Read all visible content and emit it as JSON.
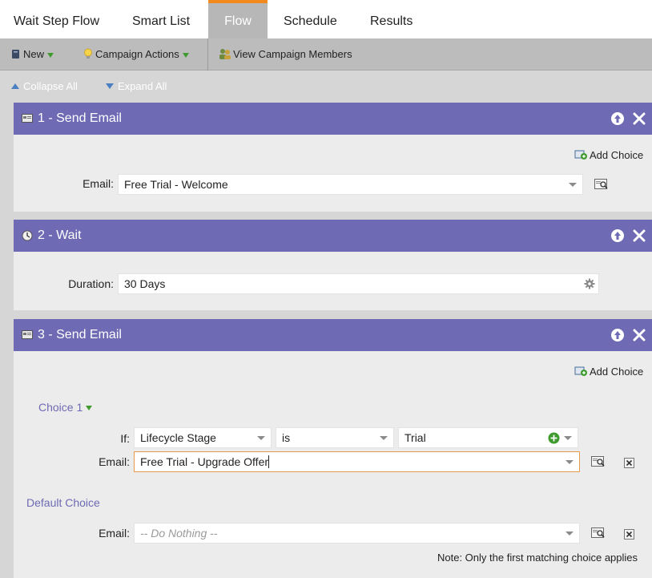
{
  "tabs": [
    {
      "label": "Wait Step Flow"
    },
    {
      "label": "Smart List"
    },
    {
      "label": "Flow",
      "active": true
    },
    {
      "label": "Schedule"
    },
    {
      "label": "Results"
    }
  ],
  "toolbar": {
    "new_label": "New",
    "campaign_actions_label": "Campaign Actions",
    "view_members_label": "View Campaign Members"
  },
  "controls": {
    "collapse_all": "Collapse All",
    "expand_all": "Expand All"
  },
  "steps": [
    {
      "title": "1 - Send Email",
      "add_choice": "Add Choice",
      "email_label": "Email:",
      "email_value": "Free Trial - Welcome"
    },
    {
      "title": "2 - Wait",
      "duration_label": "Duration:",
      "duration_value": "30 Days"
    },
    {
      "title": "3 - Send Email",
      "add_choice": "Add Choice",
      "choice_label": "Choice 1",
      "if_label": "If:",
      "condition_field": "Lifecycle Stage",
      "condition_operator": "is",
      "condition_value": "Trial",
      "email_label": "Email:",
      "choice_email_value": "Free Trial - Upgrade Offer",
      "default_choice_label": "Default Choice",
      "default_email_label": "Email:",
      "default_email_placeholder": "-- Do Nothing --",
      "note": "Note: Only the first matching choice applies"
    }
  ],
  "colors": {
    "step_header": "#6e6ab4",
    "active_tab_accent": "#f28a1e",
    "add_green": "#3f9b2e"
  }
}
